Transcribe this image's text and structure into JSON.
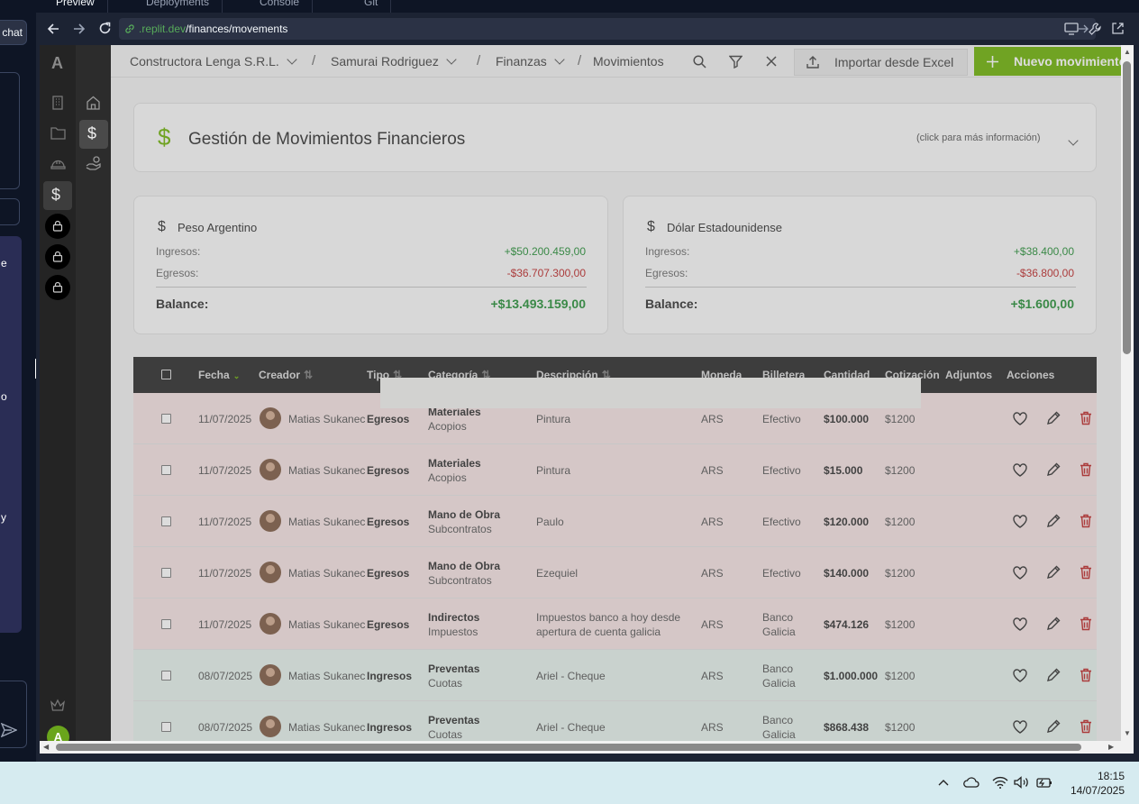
{
  "replit": {
    "tabs": [
      "Preview",
      "Deployments",
      "Console",
      "Git"
    ],
    "left_chat_button": "chat",
    "left_fragments": [
      "e",
      "o",
      "y"
    ],
    "url_domain": ".replit.dev",
    "url_path": "/finances/movements"
  },
  "app": {
    "logo_letter": "A",
    "avatar_letter": "A",
    "breadcrumbs": {
      "company": "Constructora Lenga S.R.L.",
      "project": "Samurai Rodriguez",
      "section": "Finanzas",
      "page": "Movimientos"
    },
    "import_label": "Importar desde Excel",
    "new_label": "Nuevo movimiento"
  },
  "header_card": {
    "title": "Gestión de Movimientos Financieros",
    "more_info": "(click para más información)"
  },
  "summaries": [
    {
      "currency": "Peso Argentino",
      "income_label": "Ingresos:",
      "income": "+$50.200.459,00",
      "expense_label": "Egresos:",
      "expense": "-$36.707.300,00",
      "balance_label": "Balance:",
      "balance": "+$13.493.159,00"
    },
    {
      "currency": "Dólar Estadounidense",
      "income_label": "Ingresos:",
      "income": "+$38.400,00",
      "expense_label": "Egresos:",
      "expense": "-$36.800,00",
      "balance_label": "Balance:",
      "balance": "+$1.600,00"
    }
  ],
  "table": {
    "headers": [
      "Fecha",
      "Creador",
      "Tipo",
      "Categoría",
      "Descripción",
      "Moneda",
      "Billetera",
      "Cantidad",
      "Cotización",
      "Adjuntos",
      "Acciones"
    ],
    "rows": [
      {
        "date": "11/07/2025",
        "creator": "Matias Sukanec",
        "type": "Egresos",
        "cat": "Materiales",
        "subcat": "Acopios",
        "desc1": "Pintura",
        "desc2": "",
        "currency": "ARS",
        "wallet1": "Efectivo",
        "wallet2": "",
        "amount": "$100.000",
        "rate": "$1200"
      },
      {
        "date": "11/07/2025",
        "creator": "Matias Sukanec",
        "type": "Egresos",
        "cat": "Materiales",
        "subcat": "Acopios",
        "desc1": "Pintura",
        "desc2": "",
        "currency": "ARS",
        "wallet1": "Efectivo",
        "wallet2": "",
        "amount": "$15.000",
        "rate": "$1200"
      },
      {
        "date": "11/07/2025",
        "creator": "Matias Sukanec",
        "type": "Egresos",
        "cat": "Mano de Obra",
        "subcat": "Subcontratos",
        "desc1": "Paulo",
        "desc2": "",
        "currency": "ARS",
        "wallet1": "Efectivo",
        "wallet2": "",
        "amount": "$120.000",
        "rate": "$1200"
      },
      {
        "date": "11/07/2025",
        "creator": "Matias Sukanec",
        "type": "Egresos",
        "cat": "Mano de Obra",
        "subcat": "Subcontratos",
        "desc1": "Ezequiel",
        "desc2": "",
        "currency": "ARS",
        "wallet1": "Efectivo",
        "wallet2": "",
        "amount": "$140.000",
        "rate": "$1200"
      },
      {
        "date": "11/07/2025",
        "creator": "Matias Sukanec",
        "type": "Egresos",
        "cat": "Indirectos",
        "subcat": "Impuestos",
        "desc1": "Impuestos banco a hoy desde",
        "desc2": "apertura de cuenta galicia",
        "currency": "ARS",
        "wallet1": "Banco",
        "wallet2": "Galicia",
        "amount": "$474.126",
        "rate": "$1200"
      },
      {
        "date": "08/07/2025",
        "creator": "Matias Sukanec",
        "type": "Ingresos",
        "cat": "Preventas",
        "subcat": "Cuotas",
        "desc1": "Ariel - Cheque",
        "desc2": "",
        "currency": "ARS",
        "wallet1": "Banco",
        "wallet2": "Galicia",
        "amount": "$1.000.000",
        "rate": "$1200"
      },
      {
        "date": "08/07/2025",
        "creator": "Matias Sukanec",
        "type": "Ingresos",
        "cat": "Preventas",
        "subcat": "Cuotas",
        "desc1": "Ariel - Cheque",
        "desc2": "",
        "currency": "ARS",
        "wallet1": "Banco",
        "wallet2": "Galicia",
        "amount": "$868.438",
        "rate": "$1200"
      }
    ]
  },
  "taskbar": {
    "time": "18:15",
    "date": "14/07/2025"
  },
  "colors": {
    "accent_green": "#7cba1e",
    "income_row": "#e8f3ee",
    "expense_row": "#f7e6e6",
    "income_text": "#3a9a4a",
    "expense_text": "#c43b3b"
  }
}
